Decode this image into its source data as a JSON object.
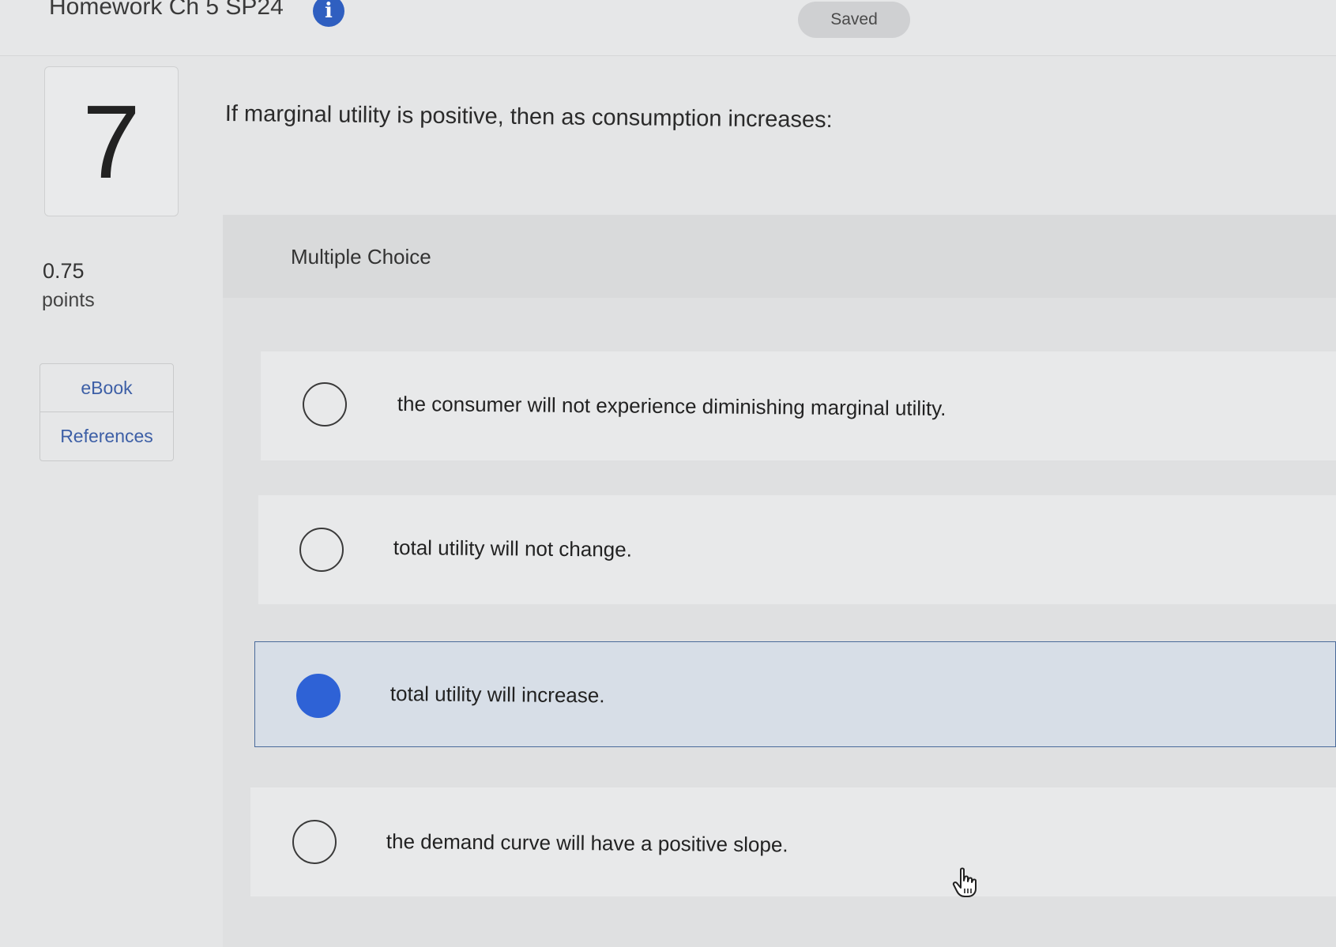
{
  "header": {
    "assignment_title": "Homework Ch 5 SP24",
    "info_icon_glyph": "i",
    "saved_label": "Saved"
  },
  "question": {
    "number": "7",
    "text": "If marginal utility is positive, then as consumption increases:",
    "points_value": "0.75",
    "points_label": "points"
  },
  "tools": {
    "ebook_label": "eBook",
    "references_label": "References"
  },
  "answer": {
    "type_label": "Multiple Choice",
    "selected_index": 2,
    "options": [
      "the consumer will not experience diminishing marginal utility.",
      "total utility will not change.",
      "total utility will increase.",
      "the demand curve will have a positive slope."
    ]
  },
  "colors": {
    "accent": "#2e62d6",
    "link": "#3d5fa6"
  }
}
